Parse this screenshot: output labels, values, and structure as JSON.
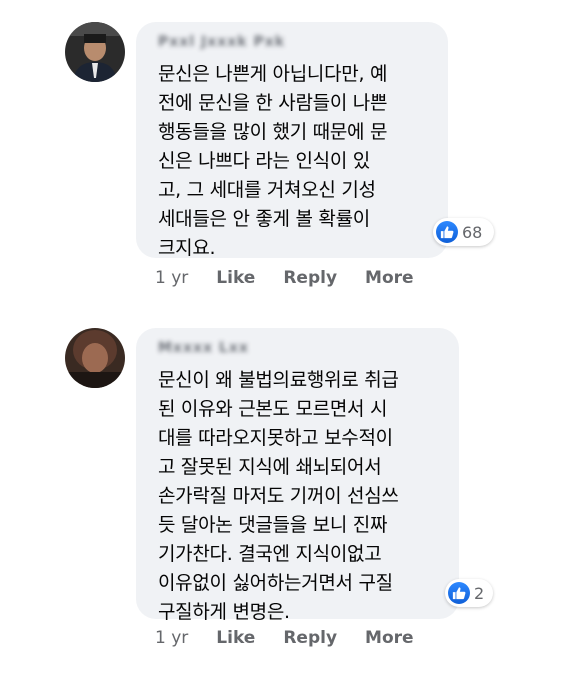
{
  "comments": [
    {
      "author": "Pxxl Jxxxk Pxk",
      "text": "문신은 나쁜게 아닙니다만, 예\n전에 문신을 한 사람들이 나쁜\n행동들을 많이 했기 때문에 문\n신은 나쁘다 라는 인식이 있\n고, 그 세대를 거쳐오신 기성\n세대들은 안 좋게 볼 확률이\n크지요.",
      "reaction_count": "68",
      "timestamp": "1 yr",
      "like_label": "Like",
      "reply_label": "Reply",
      "more_label": "More"
    },
    {
      "author": "Mxxxx Lxx",
      "text": "문신이 왜 불법의료행위로 취급\n된 이유와 근본도 모르면서 시\n대를 따라오지못하고 보수적이\n고 잘못된 지식에 쇄뇌되어서\n손가락질 마저도 기꺼이 선심쓰\n듯 달아논 댓글들을 보니 진짜\n기가찬다. 결국엔 지식이없고\n이유없이 싫어하는거면서 구질\n구질하게 변명은.",
      "reaction_count": "2",
      "timestamp": "1 yr",
      "like_label": "Like",
      "reply_label": "Reply",
      "more_label": "More"
    }
  ],
  "colors": {
    "bubble": "#f0f2f5",
    "text": "#050505",
    "meta": "#65676b",
    "like_blue": "#1877f2"
  },
  "icons": [
    "like-thumb-icon",
    "avatar"
  ]
}
